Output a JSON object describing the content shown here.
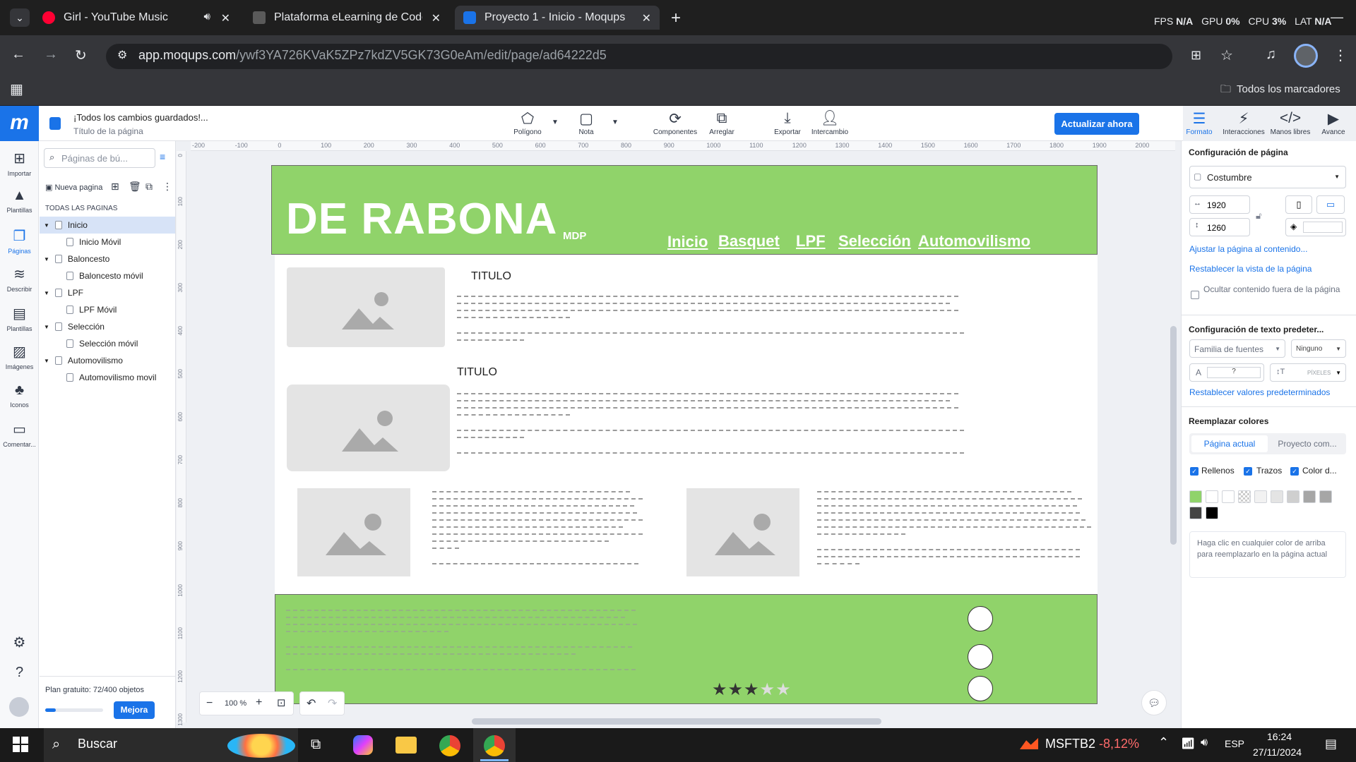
{
  "browser": {
    "tabs": [
      {
        "title": "Girl - YouTube Music",
        "color": "#ff0033"
      },
      {
        "title": "Plataforma eLearning de Coder",
        "color": "#5a5a5a"
      },
      {
        "title": "Proyecto 1 - Inicio - Moqups",
        "color": "#1a73e8"
      }
    ],
    "new_tab_icon": "+",
    "perf": {
      "fps_label": "FPS",
      "fps": "N/A",
      "gpu_label": "GPU",
      "gpu": "0%",
      "cpu_label": "CPU",
      "cpu": "3%",
      "lat_label": "LAT",
      "lat": "N/A"
    },
    "url_host": "app.moqups.com",
    "url_path": "/ywf3YA726KVaK5ZPz7kdZV5GK73G0eAm/edit/page/ad64222d5",
    "bookmarks_label": "Todos los marcadores"
  },
  "app": {
    "logo": "m",
    "save_status": "¡Todos los cambios guardados!...",
    "page_title_hint": "Título de la página",
    "tools": [
      {
        "label": "Polígono",
        "icon": "polygon-icon"
      },
      {
        "label": "Nota",
        "icon": "note-icon"
      },
      {
        "label": "Componentes",
        "icon": "components-icon"
      },
      {
        "label": "Arreglar",
        "icon": "arrange-icon"
      },
      {
        "label": "Exportar",
        "icon": "export-icon"
      },
      {
        "label": "Intercambio",
        "icon": "share-icon"
      }
    ],
    "update_button": "Actualizar ahora",
    "right_tabs": [
      "Formato",
      "Interacciones",
      "Manos libres",
      "Avance"
    ],
    "rail": [
      "Importar",
      "Plantillas",
      "Páginas",
      "Describir",
      "Plantillas",
      "Imágenes",
      "Iconos",
      "Comentar..."
    ],
    "search_placeholder": "Páginas de bú...",
    "new_page": "Nueva pagina",
    "all_pages": "TODAS LAS PAGINAS",
    "pages": [
      {
        "label": "Inicio",
        "level": 0,
        "selected": true
      },
      {
        "label": "Inicio Móvil",
        "level": 1
      },
      {
        "label": "Baloncesto",
        "level": 0
      },
      {
        "label": "Baloncesto móvil",
        "level": 1
      },
      {
        "label": "LPF",
        "level": 0
      },
      {
        "label": "LPF Móvil",
        "level": 1
      },
      {
        "label": "Selección",
        "level": 0
      },
      {
        "label": "Selección móvil",
        "level": 1
      },
      {
        "label": "Automovilismo",
        "level": 0
      },
      {
        "label": "Automovilismo movil",
        "level": 1
      }
    ],
    "plan": "Plan gratuito: 72/400 objetos",
    "plan_progress": 0.18,
    "upgrade": "Mejora",
    "zoom": "100 %",
    "ruler_h": [
      "-200",
      "-100",
      "0",
      "100",
      "200",
      "300",
      "400",
      "500",
      "600",
      "700",
      "800",
      "900",
      "1000",
      "1100",
      "1200",
      "1300",
      "1400",
      "1500",
      "1600",
      "1700",
      "1800",
      "1900",
      "2000"
    ],
    "ruler_v": [
      "0",
      "100",
      "200",
      "300",
      "400",
      "500",
      "600",
      "700",
      "800",
      "900",
      "1000",
      "1100",
      "1200",
      "1300"
    ]
  },
  "mockup": {
    "brand": "DE RABONA",
    "sub": "MDP",
    "nav": [
      "Inicio",
      "Basquet",
      "LPF",
      "Selección",
      "Automovilismo"
    ],
    "title1": "TITULO",
    "title2": "TITULO",
    "header_color": "#90d36a",
    "rating": 3,
    "rating_max": 5
  },
  "format": {
    "page_config": "Configuración de página",
    "preset": "Costumbre",
    "width": "1920",
    "height": "1260",
    "fit": "Ajustar la página al contenido...",
    "reset_view": "Restablecer la vista de la página",
    "hide_outside": "Ocultar contenido fuera de la página",
    "text_config": "Configuración de texto predeter...",
    "font_family": "Familia de fuentes",
    "font_none": "Ninguno",
    "font_size": "?",
    "pixels": "PÍXELES",
    "reset_defaults": "Restablecer valores predeterminados",
    "replace_colors": "Reemplazar colores",
    "seg_current": "Página actual",
    "seg_project": "Proyecto com...",
    "checks": [
      "Rellenos",
      "Trazos",
      "Color d..."
    ],
    "swatches": [
      "#90d36a",
      "#ffffff",
      "#ffffff",
      "checker",
      "#f2f2f2",
      "#e4e4e4",
      "#cfcfcf",
      "#a6a6a6",
      "#a6a6a6",
      "#444444",
      "#000000"
    ],
    "hint": "Haga clic en cualquier color de arriba para reemplazarlo en la página actual"
  },
  "taskbar": {
    "search": "Buscar",
    "stock": "MSFTB2",
    "stock_change": "-8,12%",
    "lang": "ESP",
    "time": "16:24",
    "date": "27/11/2024"
  }
}
